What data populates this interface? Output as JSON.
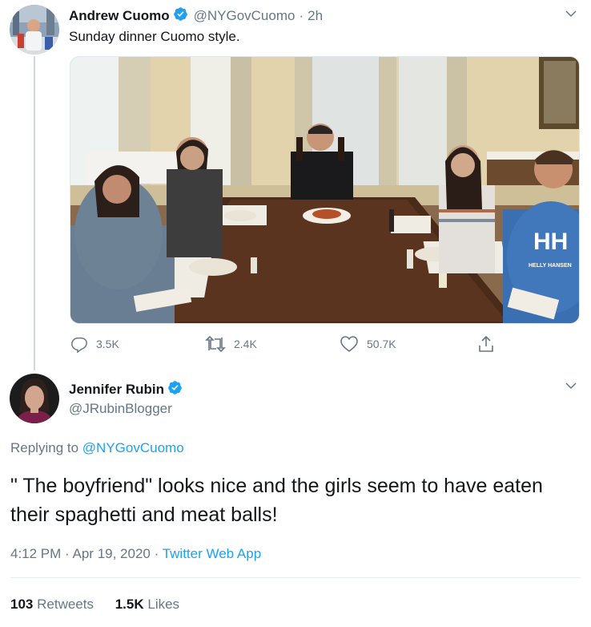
{
  "tweet1": {
    "author_name": "Andrew Cuomo",
    "handle": "@NYGovCuomo",
    "separator": "·",
    "time": "2h",
    "text": "Sunday dinner Cuomo style.",
    "photo_shirt_text_1": "HH",
    "photo_shirt_text_2": "HELLY HANSEN",
    "stats": {
      "replies": "3.5K",
      "retweets": "2.4K",
      "likes": "50.7K"
    }
  },
  "tweet2": {
    "author_name": "Jennifer Rubin",
    "handle": "@JRubinBlogger",
    "replying_prefix": "Replying to",
    "replying_to": "@NYGovCuomo",
    "text": "\" The boyfriend\" looks nice and the girls seem to have eaten their spaghetti and meat balls!",
    "time": "4:12 PM",
    "date": "Apr 19, 2020",
    "meta_separator": "·",
    "source": "Twitter Web App",
    "retweet_count": "103",
    "retweet_label": "Retweets",
    "like_count": "1.5K",
    "like_label": "Likes"
  },
  "colors": {
    "twitter_blue": "#1da1f2",
    "secondary_text": "#657786",
    "primary_text": "#14171a"
  },
  "icons": [
    "verified-badge-icon",
    "chevron-down-icon",
    "reply-icon",
    "retweet-icon",
    "like-icon",
    "share-icon"
  ]
}
